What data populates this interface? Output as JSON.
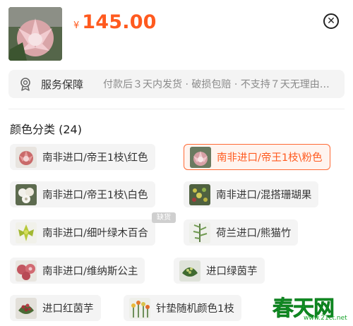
{
  "header": {
    "currency": "¥",
    "price": "145.00"
  },
  "service": {
    "label": "服务保障",
    "text": "付款后３天内发货 · 破损包赔 · 不支持７天无理由退货"
  },
  "section": {
    "title": "颜色分类 (24)"
  },
  "options": [
    {
      "label": "南非进口/帝王1枝\\红色"
    },
    {
      "label": "南非进口/帝王1枝\\粉色"
    },
    {
      "label": "南非进口/帝王1枝\\白色"
    },
    {
      "label": "南非进口/混搭珊瑚果"
    },
    {
      "label": "南非进口/细叶绿木百合"
    },
    {
      "label": "荷兰进口/熊猫竹"
    },
    {
      "label": "南非进口/维纳斯公主"
    },
    {
      "label": "进口绿茵芋"
    },
    {
      "label": "进口红茵芋"
    },
    {
      "label": "针垫随机颜色1枝"
    }
  ],
  "badge": {
    "out_of_stock": "缺货"
  },
  "selected_option": "南非进口/帝王1枝\\粉色",
  "accent_color": "#ff5a1f",
  "watermark": {
    "main": "春天网",
    "url": "www.21ct.net"
  }
}
